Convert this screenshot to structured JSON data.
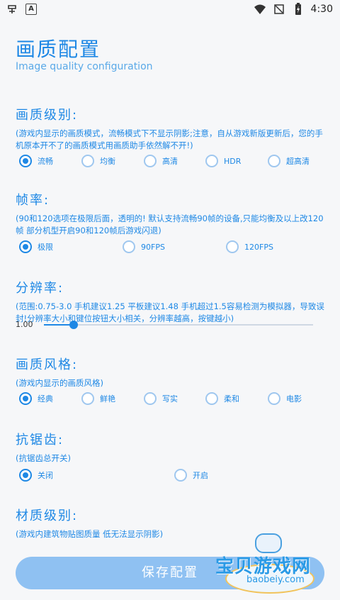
{
  "status_bar": {
    "time": "4:30",
    "left_icons": [
      "app-icon",
      "a-badge-icon"
    ],
    "right_icons": [
      "wifi-icon",
      "no-signal-icon",
      "battery-charging-icon"
    ],
    "a_badge": "A"
  },
  "header": {
    "title": "画质配置",
    "subtitle": "Image quality configuration"
  },
  "sections": {
    "quality": {
      "title": "画质级别:",
      "desc": "(游戏内显示的画质模式，流畅模式下不显示阴影;注意，自从游戏新版更新后，您的手机原本开不了的画质模式用画质助手依然解不开!)",
      "options": [
        "流畅",
        "均衡",
        "高清",
        "HDR",
        "超高清"
      ],
      "selected": 0
    },
    "framerate": {
      "title": "帧率:",
      "desc": "(90和120选项在极限后面，透明的! 默认支持流畅90帧的设备,只能均衡及以上改120帧  部分机型开启90和120帧后游戏闪退)",
      "options": [
        "极限",
        "90FPS",
        "120FPS"
      ],
      "selected": 0
    },
    "resolution": {
      "title": "分辨率:",
      "desc": "(范围:0.75-3.0  手机建议1.25 平板建议1.48  手机超过1.5容易检测为模拟器，导致误封!分辨率大小和键位按钮大小相关，分辨率越高，按键越小)",
      "value": "1.00",
      "fraction": 0.11
    },
    "style": {
      "title": "画质风格:",
      "desc": "(游戏内显示的画质风格)",
      "options": [
        "经典",
        "鲜艳",
        "写实",
        "柔和",
        "电影"
      ],
      "selected": 0
    },
    "antialias": {
      "title": "抗锯齿:",
      "desc": "(抗锯齿总开关)",
      "options": [
        "关闭",
        "开启"
      ],
      "selected": 0
    },
    "material": {
      "title": "材质级别:",
      "desc": "(游戏内建筑物贴图质量 低无法显示阴影)"
    }
  },
  "save_button": "保存配置",
  "watermark": {
    "text": "宝贝游戏网",
    "url": "baobeiy.com"
  },
  "colors": {
    "accent": "#1e88e5",
    "button": "#8fc1f2",
    "background": "#f6f7f9"
  }
}
